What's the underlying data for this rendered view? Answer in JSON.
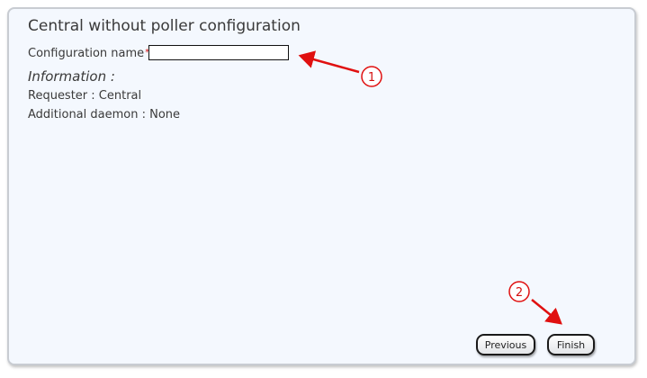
{
  "dialog": {
    "title": "Central without poller configuration",
    "config_name_label": "Configuration name",
    "required_mark": "*",
    "config_name_value": "",
    "info_title": "Information :",
    "requester_line": "Requester : Central",
    "daemon_line": "Additional daemon : None"
  },
  "buttons": {
    "previous_label": "Previous",
    "finish_label": "Finish"
  },
  "annotations": {
    "marker_1": "1",
    "marker_2": "2",
    "color": "#d41010"
  }
}
